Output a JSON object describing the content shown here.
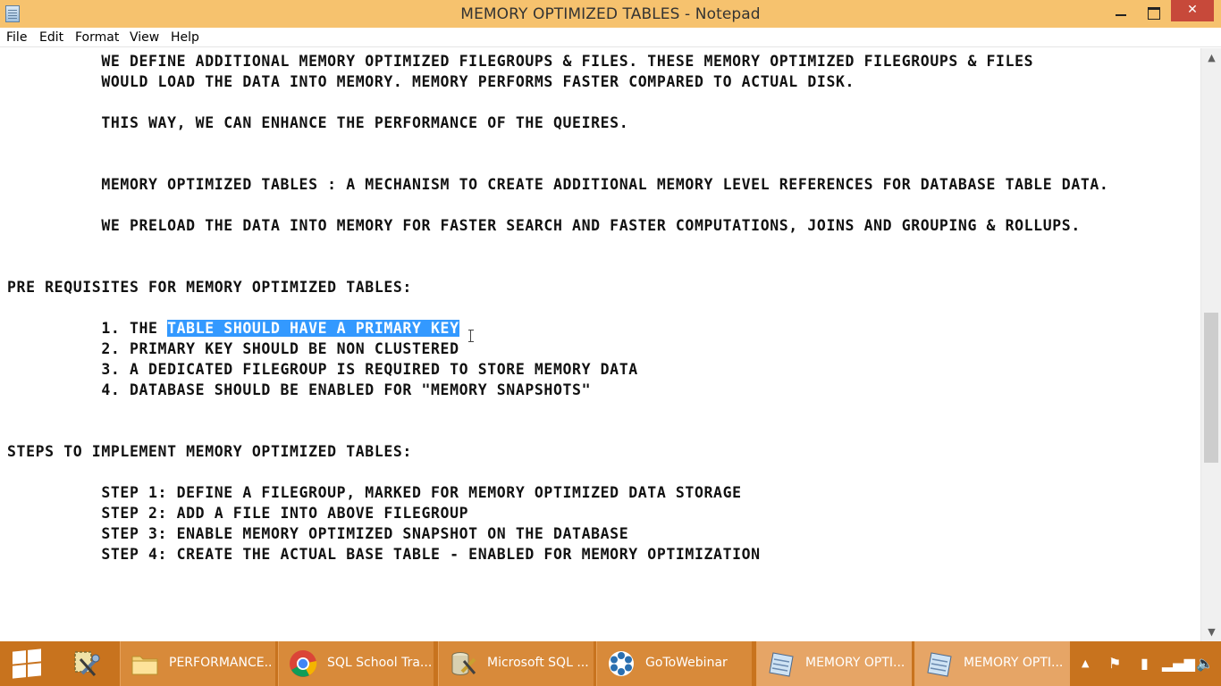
{
  "window": {
    "title": "MEMORY OPTIMIZED TABLES - Notepad",
    "icon": "notepad-icon"
  },
  "menu": {
    "file": "File",
    "edit": "Edit",
    "format": "Format",
    "view": "View",
    "help": "Help"
  },
  "document": {
    "lines": [
      "          WE DEFINE ADDITIONAL MEMORY OPTIMIZED FILEGROUPS & FILES. THESE MEMORY OPTIMIZED FILEGROUPS & FILES",
      "          WOULD LOAD THE DATA INTO MEMORY. MEMORY PERFORMS FASTER COMPARED TO ACTUAL DISK.",
      "",
      "          THIS WAY, WE CAN ENHANCE THE PERFORMANCE OF THE QUEIRES.",
      "",
      "",
      "          MEMORY OPTIMIZED TABLES : A MECHANISM TO CREATE ADDITIONAL MEMORY LEVEL REFERENCES FOR DATABASE TABLE DATA.",
      "",
      "          WE PRELOAD THE DATA INTO MEMORY FOR FASTER SEARCH AND FASTER COMPUTATIONS, JOINS AND GROUPING & ROLLUPS.",
      "",
      "",
      "PRE REQUISITES FOR MEMORY OPTIMIZED TABLES:",
      "",
      "",
      "          2. PRIMARY KEY SHOULD BE NON CLUSTERED",
      "          3. A DEDICATED FILEGROUP IS REQUIRED TO STORE MEMORY DATA",
      "          4. DATABASE SHOULD BE ENABLED FOR \"MEMORY SNAPSHOTS\"",
      "",
      "",
      "STEPS TO IMPLEMENT MEMORY OPTIMIZED TABLES:",
      "",
      "          STEP 1: DEFINE A FILEGROUP, MARKED FOR MEMORY OPTIMIZED DATA STORAGE",
      "          STEP 2: ADD A FILE INTO ABOVE FILEGROUP",
      "          STEP 3: ENABLE MEMORY OPTIMIZED SNAPSHOT ON THE DATABASE",
      "          STEP 4: CREATE THE ACTUAL BASE TABLE - ENABLED FOR MEMORY OPTIMIZATION"
    ],
    "selected_line": {
      "prefix": "          1. THE ",
      "selection": "TABLE SHOULD HAVE A PRIMARY KEY"
    },
    "selection_color": "#3399ff"
  },
  "taskbar": {
    "color": "#c8731e",
    "items": [
      {
        "label": "PERFORMANCE...",
        "icon": "folder-icon"
      },
      {
        "label": "SQL School Tra...",
        "icon": "chrome-icon"
      },
      {
        "label": "Microsoft SQL ...",
        "icon": "sql-server-icon"
      },
      {
        "label": "GoToWebinar",
        "icon": "gotowebinar-icon"
      },
      {
        "label": "MEMORY OPTI...",
        "icon": "notepad-icon"
      },
      {
        "label": "MEMORY OPTI...",
        "icon": "notepad-icon"
      }
    ],
    "tray": [
      "chevron-up-icon",
      "flag-icon",
      "battery-icon",
      "signal-icon",
      "volume-icon"
    ]
  },
  "accent": {
    "titlebar": "#f6c26e",
    "close_button": "#c7493a"
  }
}
